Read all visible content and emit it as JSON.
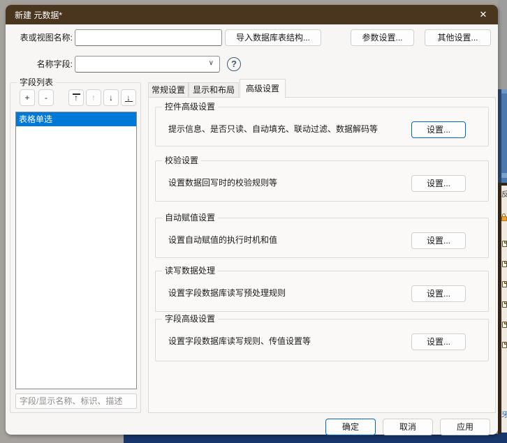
{
  "window": {
    "title": "新建 元数据*",
    "close_glyph": "✕"
  },
  "form": {
    "table_name_label": "表或视图名称:",
    "table_name_value": "",
    "import_button": "导入数据库表结构...",
    "param_button": "参数设置...",
    "other_button": "其他设置...",
    "name_field_label": "名称字段:",
    "name_field_value": "",
    "combo_chevron": "∨",
    "help_glyph": "?"
  },
  "field_list": {
    "title": "字段列表",
    "toolbar": {
      "add": "+",
      "remove": "-",
      "move_top": "↑",
      "move_up": "↑",
      "move_down": "↓",
      "move_bottom": "↓"
    },
    "items": [
      {
        "label": "表格单选",
        "selected": true
      }
    ],
    "filter_placeholder": "字段/显示名称、标识、描述"
  },
  "tabs": [
    {
      "label": "常规设置",
      "active": false
    },
    {
      "label": "显示和布局",
      "active": false
    },
    {
      "label": "高级设置",
      "active": true
    }
  ],
  "groups": [
    {
      "title": "控件高级设置",
      "desc": "提示信息、是否只读、自动填充、联动过滤、数据解码等",
      "button": "设置...",
      "focused": true
    },
    {
      "title": "校验设置",
      "desc": "设置数据回写时的校验规则等",
      "button": "设置...",
      "focused": false
    },
    {
      "title": "自动赋值设置",
      "desc": "设置自动赋值的执行时机和值",
      "button": "设置...",
      "focused": false
    },
    {
      "title": "读写数据处理",
      "desc": "设置字段数据库读写预处理规则",
      "button": "设置...",
      "focused": false
    },
    {
      "title": "字段高级设置",
      "desc": "设置字段数据库读写规则、传值设置等",
      "button": "设置...",
      "focused": false
    }
  ],
  "footer": {
    "ok": "确定",
    "cancel": "取消",
    "apply": "应用"
  },
  "background_edge": {
    "char_top": "反",
    "char_bottom": "牙"
  },
  "colors": {
    "titlebar": "#4a351f",
    "dialog_bg": "#f7f6f4",
    "selection": "#0078d7",
    "focus_border": "#0067c0",
    "bottom_bar": "#17366b",
    "edge_blue": "#4b79af"
  }
}
